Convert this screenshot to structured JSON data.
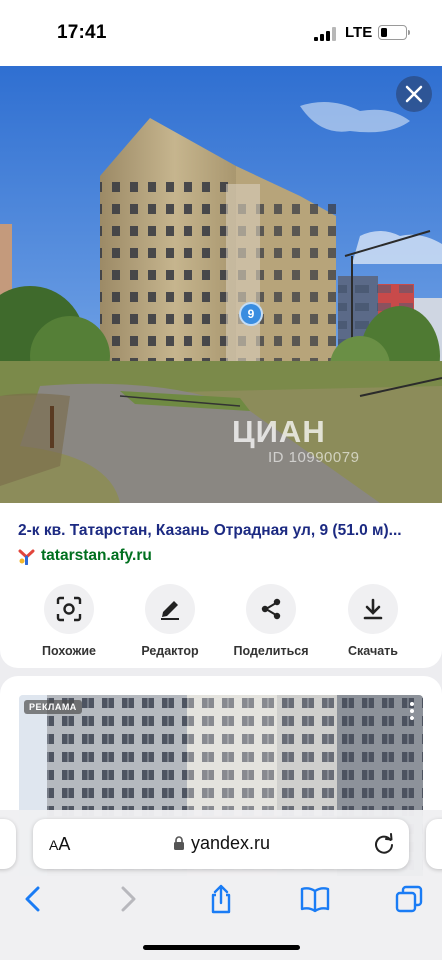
{
  "status_bar": {
    "time": "17:41",
    "network": "LTE",
    "battery_level": 0.25
  },
  "image_result": {
    "watermark_brand": "ЦИАН",
    "watermark_id": "ID 10990079",
    "pin_number": "9",
    "title": "2-к кв. Татарстан, Казань Отрадная ул, 9 (51.0 м)...",
    "source_url": "tatarstan.afy.ru",
    "close_icon": "close-icon"
  },
  "actions": [
    {
      "label": "Похожие",
      "icon": "similar-search-icon"
    },
    {
      "label": "Редактор",
      "icon": "pencil-icon"
    },
    {
      "label": "Поделиться",
      "icon": "share-icon"
    },
    {
      "label": "Скачать",
      "icon": "download-icon"
    }
  ],
  "ad_card": {
    "badge": "РЕКЛАМА"
  },
  "browser": {
    "text_size_label_big": "A",
    "text_size_label_small": "A",
    "url": "yandex.ru",
    "toolbar": [
      "back-icon",
      "forward-icon",
      "share-icon",
      "bookmarks-icon",
      "tabs-icon"
    ]
  },
  "colors": {
    "title_blue": "#1c2a82",
    "source_green": "#00701f",
    "ios_blue": "#1a7cf5"
  }
}
